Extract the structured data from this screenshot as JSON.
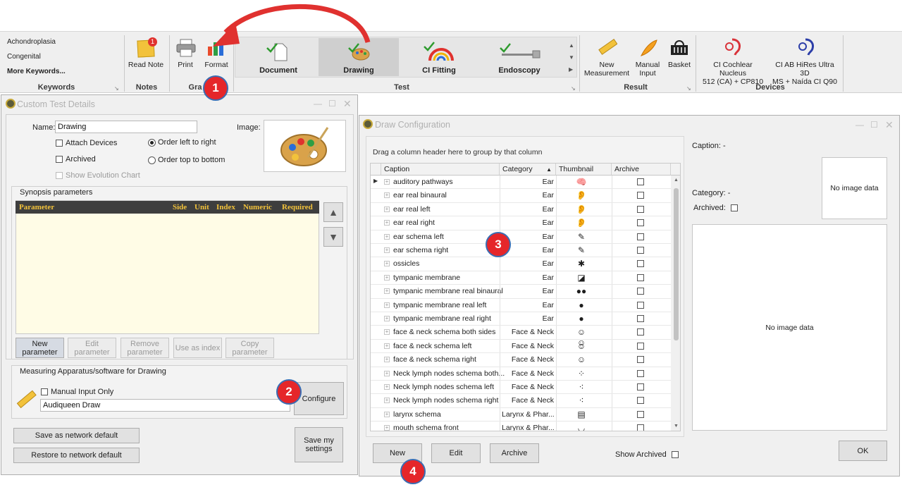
{
  "ribbon": {
    "keywords": {
      "items": [
        "Achondroplasia",
        "Congenital",
        "More Keywords..."
      ],
      "group_label": "Keywords"
    },
    "notes": {
      "read_note": "Read Note",
      "badge_count": "1",
      "group_label": "Notes"
    },
    "graph": {
      "print": "Print",
      "format": "Format",
      "group_label": "Gra"
    },
    "test": {
      "group_label": "Test",
      "items": [
        {
          "label": "Document",
          "icon": "document-check-icon"
        },
        {
          "label": "Drawing",
          "icon": "palette-check-icon"
        },
        {
          "label": "CI Fitting",
          "icon": "ci-fitting-icon"
        },
        {
          "label": "Endoscopy",
          "icon": "endoscope-icon"
        }
      ],
      "selected": "Drawing"
    },
    "result": {
      "group_label": "Result",
      "new_measurement": "New\nMeasurement",
      "manual_input": "Manual\nInput",
      "basket": "Basket"
    },
    "devices": {
      "group_label": "Devices",
      "items": [
        {
          "label": "CI Cochlear Nucleus\n512 (CA) + CP810",
          "color": "#d9333a"
        },
        {
          "label": "CI AB HiRes Ultra 3D\nMS + Naída CI Q90",
          "color": "#2c3ea8"
        }
      ]
    }
  },
  "custom_test": {
    "title": "Custom Test Details",
    "name_label": "Name:",
    "name_value": "Drawing",
    "image_label": "Image:",
    "attach_devices": "Attach Devices",
    "archived": "Archived",
    "show_evolution": "Show Evolution Chart",
    "order_ltr": "Order left to right",
    "order_ttb": "Order top to bottom",
    "synopsis_title": "Synopsis parameters",
    "synopsis_columns": [
      "Parameter",
      "Side",
      "Unit",
      "Index",
      "Numeric",
      "Required"
    ],
    "buttons": {
      "new_param": "New\nparameter",
      "edit_param": "Edit\nparameter",
      "remove_param": "Remove\nparameter",
      "use_index": "Use as index",
      "copy_param": "Copy\nparameter"
    },
    "apparatus_title": "Measuring Apparatus/software for Drawing",
    "manual_only": "Manual Input Only",
    "apparatus_value": "Audiqueen Draw",
    "configure": "Configure",
    "save_network": "Save as network default",
    "restore_network": "Restore to network default",
    "save_my": "Save my\nsettings"
  },
  "draw_config": {
    "title": "Draw Configuration",
    "group_hint": "Drag a column header here to group by that column",
    "columns": [
      "Caption",
      "Category",
      "Thumbnail",
      "Archive"
    ],
    "rows": [
      {
        "caption": "auditory pathways",
        "category": "Ear",
        "thumb": "🧠"
      },
      {
        "caption": "ear real binaural",
        "category": "Ear",
        "thumb": "👂"
      },
      {
        "caption": "ear real left",
        "category": "Ear",
        "thumb": "👂"
      },
      {
        "caption": "ear real right",
        "category": "Ear",
        "thumb": "👂"
      },
      {
        "caption": "ear schema left",
        "category": "Ear",
        "thumb": "✎"
      },
      {
        "caption": "ear schema right",
        "category": "Ear",
        "thumb": "✎"
      },
      {
        "caption": "ossicles",
        "category": "Ear",
        "thumb": "✱"
      },
      {
        "caption": "tympanic membrane",
        "category": "Ear",
        "thumb": "◪"
      },
      {
        "caption": "tympanic membrane real binaural",
        "category": "Ear",
        "thumb": "●●"
      },
      {
        "caption": "tympanic membrane real left",
        "category": "Ear",
        "thumb": "●"
      },
      {
        "caption": "tympanic membrane real right",
        "category": "Ear",
        "thumb": "●"
      },
      {
        "caption": "face & neck schema both sides",
        "category": "Face & Neck",
        "thumb": "☺☺"
      },
      {
        "caption": "face & neck schema left",
        "category": "Face & Neck",
        "thumb": "☺"
      },
      {
        "caption": "face & neck schema right",
        "category": "Face & Neck",
        "thumb": "☺"
      },
      {
        "caption": "Neck lymph nodes schema both...",
        "category": "Face & Neck",
        "thumb": "⁘"
      },
      {
        "caption": "Neck lymph nodes schema left",
        "category": "Face & Neck",
        "thumb": "⁖"
      },
      {
        "caption": "Neck lymph nodes schema right",
        "category": "Face & Neck",
        "thumb": "⁖"
      },
      {
        "caption": "larynx schema",
        "category": "Larynx & Phar...",
        "thumb": "▤"
      },
      {
        "caption": "mouth schema front",
        "category": "Larynx & Phar...",
        "thumb": "◡"
      }
    ],
    "caption_label": "Caption:",
    "caption_value": "-",
    "category_label": "Category:",
    "category_value": "-",
    "archived_label": "Archived:",
    "no_image": "No image data",
    "new": "New",
    "edit": "Edit",
    "archive": "Archive",
    "show_archived": "Show Archived",
    "ok": "OK"
  },
  "badges": [
    "1",
    "2",
    "3",
    "4"
  ]
}
